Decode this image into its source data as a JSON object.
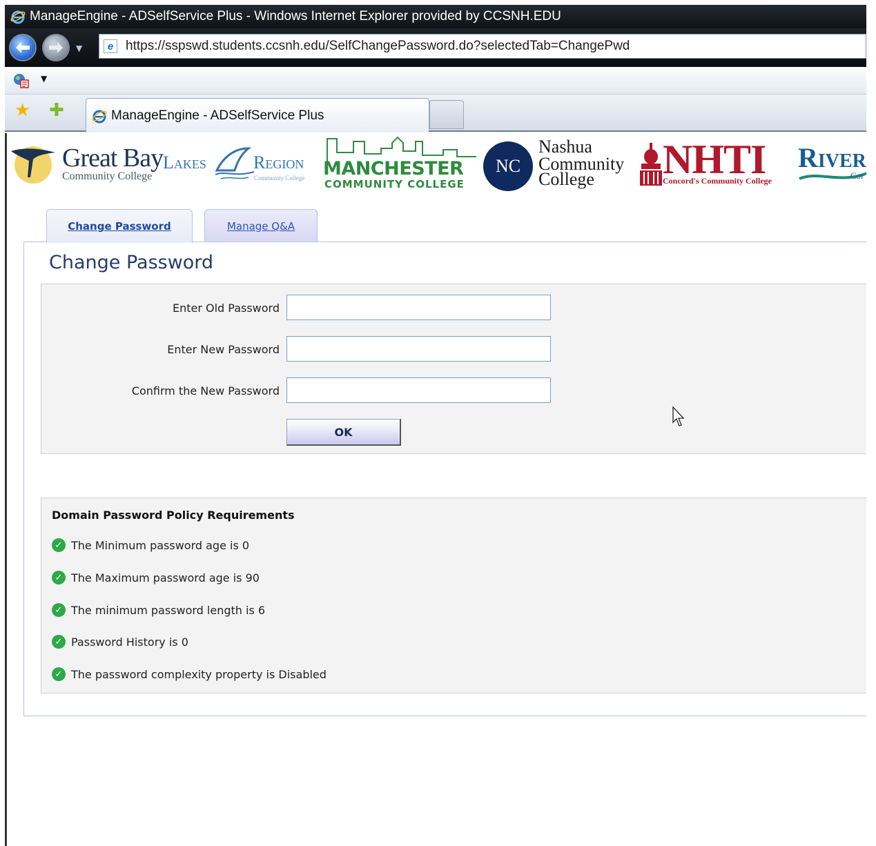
{
  "browser": {
    "window_title": "ManageEngine - ADSelfService Plus - Windows Internet Explorer provided by CCSNH.EDU",
    "url": "https://sspswd.students.ccsnh.edu/SelfChangePassword.do?selectedTab=ChangePwd",
    "tab_title": "ManageEngine - ADSelfService Plus"
  },
  "banner": {
    "great_bay": "Great Bay",
    "great_bay_sub": "Community College",
    "lakes": "Lakes",
    "region": "Region",
    "region_sub": "Community College",
    "manchester": "MANCHESTER",
    "manchester_sub": "COMMUNITY COLLEGE",
    "ncc_seal": "NC",
    "nashua_1": "Nashua",
    "nashua_2": "Community",
    "nashua_3": "College",
    "nhti": "NHTI",
    "nhti_sub": "Concord's Community College",
    "river": "River",
    "river_sub": "Cor"
  },
  "tabs": {
    "change_password": "Change Password",
    "manage_qa": "Manage Q&A"
  },
  "form": {
    "title": "Change Password",
    "old_label": "Enter Old Password",
    "new_label": "Enter New Password",
    "confirm_label": "Confirm the New Password",
    "ok_label": "OK"
  },
  "policy": {
    "title": "Domain Password Policy Requirements",
    "items": [
      "The Minimum password age is 0",
      "The Maximum password age is 90",
      "The minimum password length is 6",
      "Password History is 0",
      "The password complexity property is Disabled"
    ]
  },
  "colors": {
    "accent_blue": "#243d66",
    "tab_border": "#b9bfe6",
    "check_green": "#2ea84a"
  },
  "icons": [
    "ie-logo-icon",
    "back-arrow-icon",
    "forward-arrow-icon",
    "dropdown-caret-icon",
    "page-icon",
    "tools-icon",
    "favorites-star-icon",
    "add-favorites-icon",
    "check-icon",
    "mouse-cursor-icon"
  ]
}
